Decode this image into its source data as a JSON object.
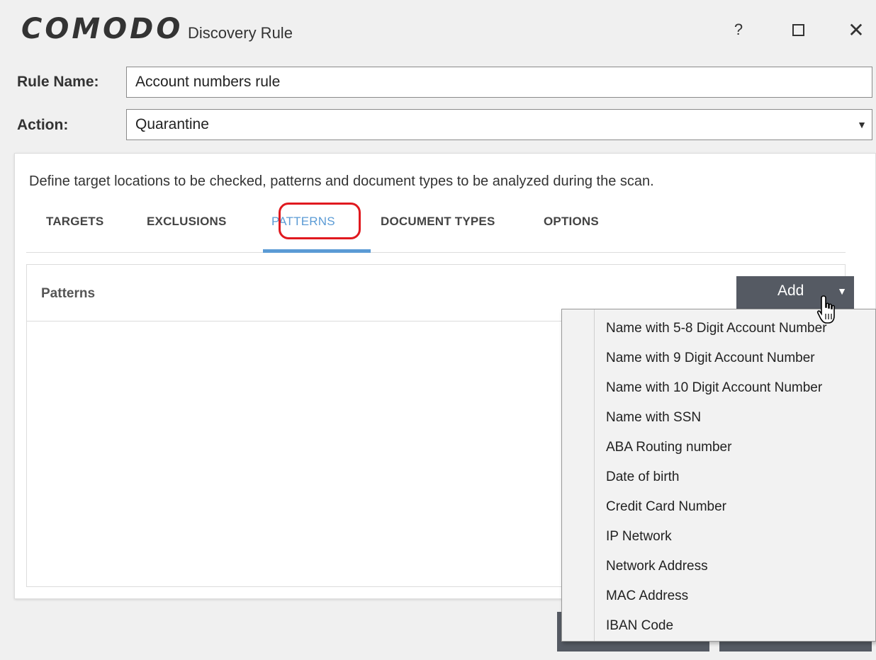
{
  "window": {
    "logo": "COMODO",
    "title": "Discovery Rule",
    "help_label": "?",
    "close_label": "✕"
  },
  "form": {
    "rule_name_label": "Rule Name:",
    "rule_name_value": "Account numbers rule",
    "action_label": "Action:",
    "action_value": "Quarantine"
  },
  "card": {
    "description": "Define target locations to be checked, patterns and document types to be analyzed during the scan.",
    "tabs": [
      {
        "label": "TARGETS"
      },
      {
        "label": "EXCLUSIONS"
      },
      {
        "label": "PATTERNS",
        "active": true
      },
      {
        "label": "DOCUMENT TYPES"
      },
      {
        "label": "OPTIONS"
      }
    ],
    "panel_title": "Patterns",
    "add_label": "Add"
  },
  "menu": {
    "items": [
      "Name with 5-8 Digit Account Number",
      "Name with 9 Digit Account Number",
      "Name with 10 Digit Account Number",
      "Name with SSN",
      "ABA Routing number",
      "Date of birth",
      "Credit Card Number",
      "IP Network",
      "Network Address",
      "MAC Address",
      "IBAN Code"
    ]
  },
  "colors": {
    "accent": "#5b9bd5",
    "highlight_circle": "#e0191f",
    "button_bg": "#555a63"
  }
}
